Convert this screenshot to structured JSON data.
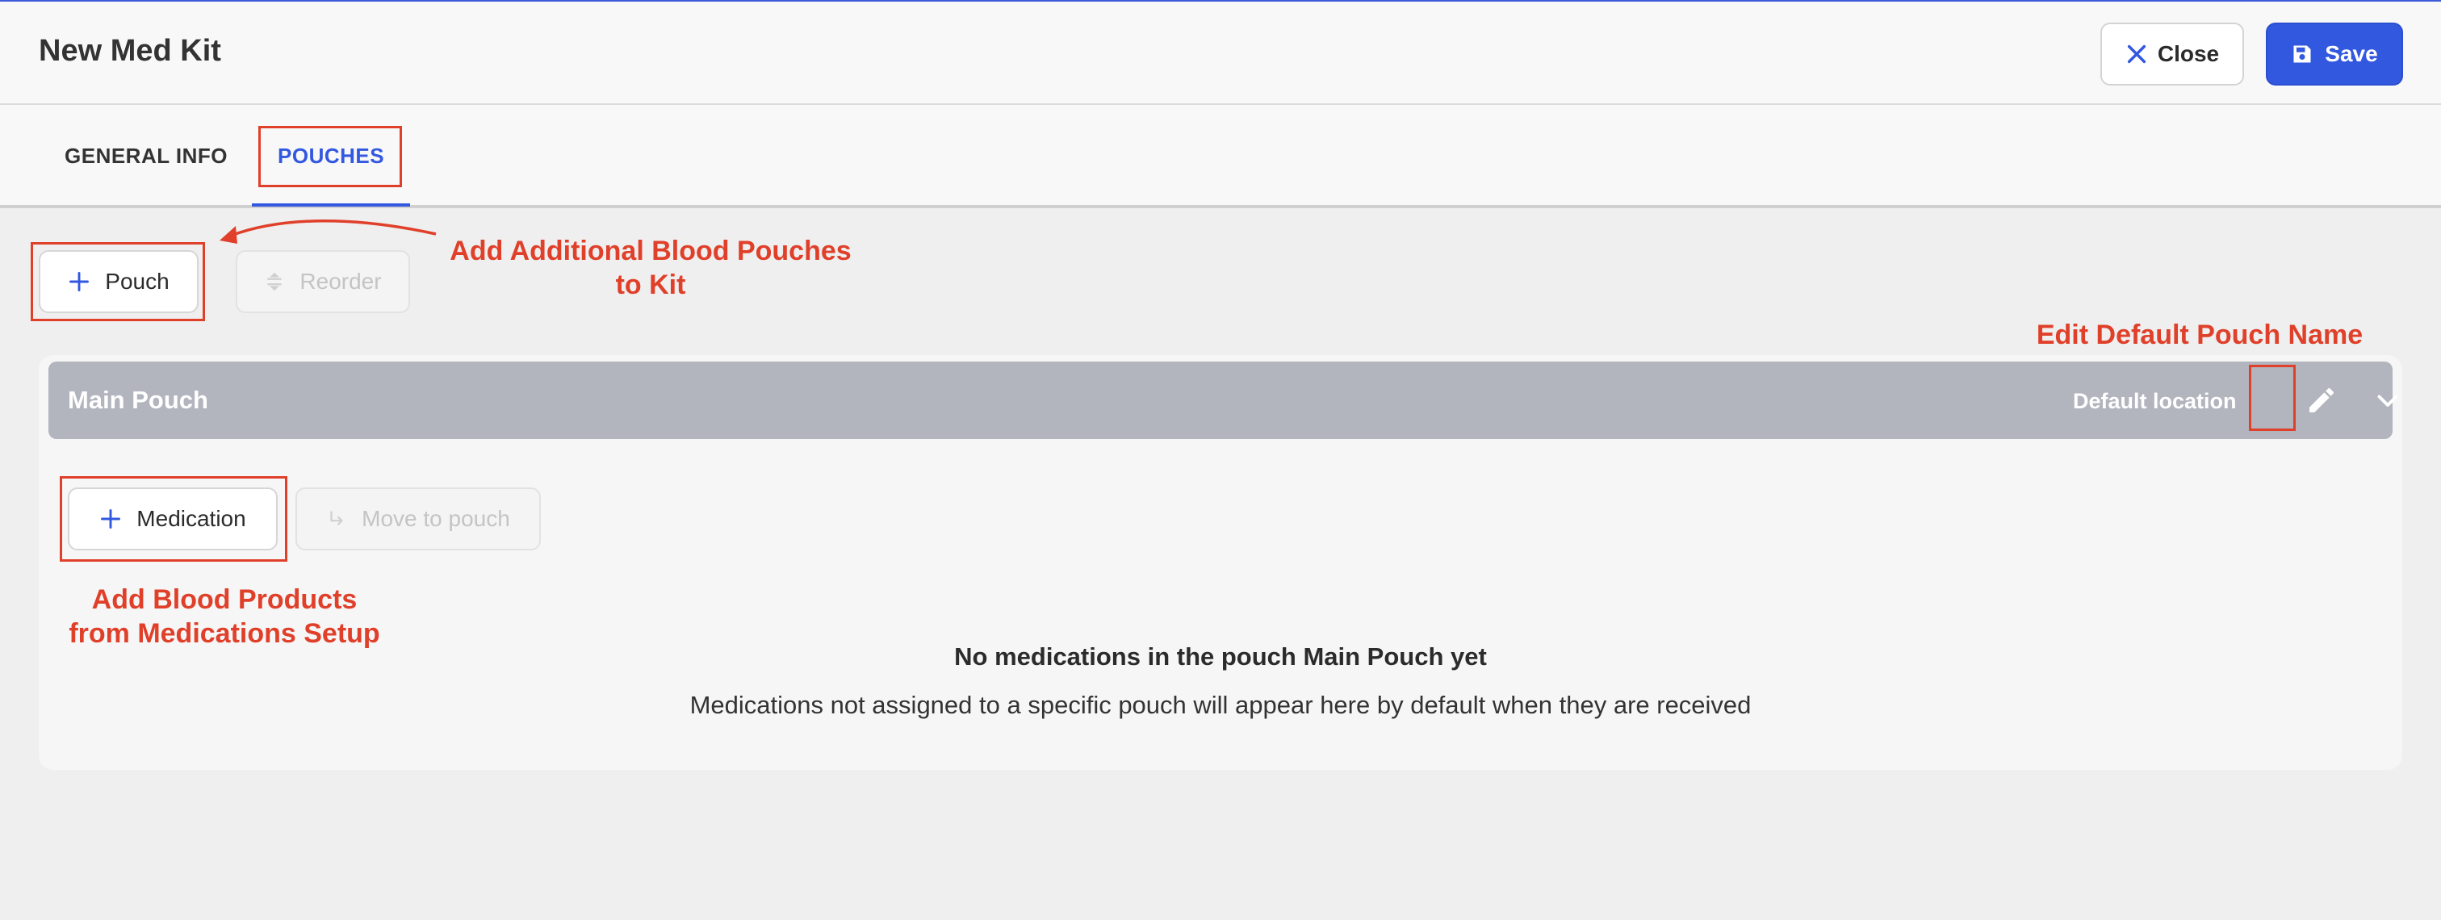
{
  "header": {
    "title": "New Med Kit",
    "close_label": "Close",
    "save_label": "Save"
  },
  "tabs": [
    {
      "label": "GENERAL INFO"
    },
    {
      "label": "POUCHES"
    }
  ],
  "toolbar": {
    "pouch_label": "Pouch",
    "reorder_label": "Reorder"
  },
  "pouch": {
    "name": "Main Pouch",
    "location_label": "Default location",
    "medication_label": "Medication",
    "move_label": "Move to pouch",
    "empty_title": "No medications in the pouch Main Pouch yet",
    "empty_subtitle": "Medications not assigned to a specific pouch will appear here by default when they are received"
  },
  "annotations": {
    "add_pouches_line1": "Add Additional Blood Pouches",
    "add_pouches_line2": "to Kit",
    "edit_name": "Edit Default Pouch Name",
    "add_products_line1": "Add Blood Products",
    "add_products_line2": "from Medications Setup"
  },
  "colors": {
    "accent": "#3358e0",
    "annotation": "#e0402a",
    "pouch_bar": "#b2b4be"
  }
}
